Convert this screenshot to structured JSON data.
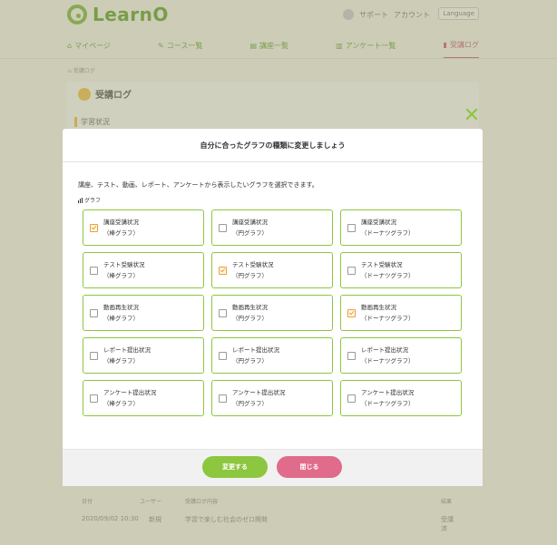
{
  "app": {
    "logo_text": "LearnO"
  },
  "header": {
    "support": "サポート",
    "account": "アカウント",
    "language": "Language"
  },
  "nav": {
    "items": [
      {
        "label": "マイページ"
      },
      {
        "label": "コース一覧"
      },
      {
        "label": "講座一覧"
      },
      {
        "label": "アンケート一覧"
      },
      {
        "label": "受講ログ"
      }
    ]
  },
  "page": {
    "title": "受講ログ",
    "section_label": "学習状況"
  },
  "table": {
    "headers": [
      "日付",
      "ユーザー",
      "受講ログ内容",
      "結果"
    ],
    "row": [
      "2020/09/02 10:30",
      "新規",
      "学習で楽しむ社会のゼロ開発",
      "受講済"
    ]
  },
  "modal": {
    "title": "自分に合ったグラフの種類に変更しましょう",
    "description": "講座、テスト、動画、レポート、アンケートから表示したいグラフを選択できます。",
    "graph_label": "グラフ",
    "options": [
      {
        "line1": "講座受講状況",
        "line2": "（棒グラフ）",
        "checked": true
      },
      {
        "line1": "講座受講状況",
        "line2": "（円グラフ）",
        "checked": false
      },
      {
        "line1": "講座受講状況",
        "line2": "（ドーナツグラフ）",
        "checked": false
      },
      {
        "line1": "テスト受験状況",
        "line2": "（棒グラフ）",
        "checked": false
      },
      {
        "line1": "テスト受験状況",
        "line2": "（円グラフ）",
        "checked": true
      },
      {
        "line1": "テスト受験状況",
        "line2": "（ドーナツグラフ）",
        "checked": false
      },
      {
        "line1": "動画再生状況",
        "line2": "（棒グラフ）",
        "checked": false
      },
      {
        "line1": "動画再生状況",
        "line2": "（円グラフ）",
        "checked": false
      },
      {
        "line1": "動画再生状況",
        "line2": "（ドーナツグラフ）",
        "checked": true
      },
      {
        "line1": "レポート提出状況",
        "line2": "（棒グラフ）",
        "checked": false
      },
      {
        "line1": "レポート提出状況",
        "line2": "（円グラフ）",
        "checked": false
      },
      {
        "line1": "レポート提出状況",
        "line2": "（ドーナツグラフ）",
        "checked": false
      },
      {
        "line1": "アンケート提出状況",
        "line2": "（棒グラフ）",
        "checked": false
      },
      {
        "line1": "アンケート提出状況",
        "line2": "（円グラフ）",
        "checked": false
      },
      {
        "line1": "アンケート提出状況",
        "line2": "（ドーナツグラフ）",
        "checked": false
      }
    ],
    "change_button": "変更する",
    "close_button": "閉じる"
  },
  "colors": {
    "accent_green": "#8dc63f",
    "close_pink": "#e06b8a",
    "check_orange": "#e8a23a"
  }
}
